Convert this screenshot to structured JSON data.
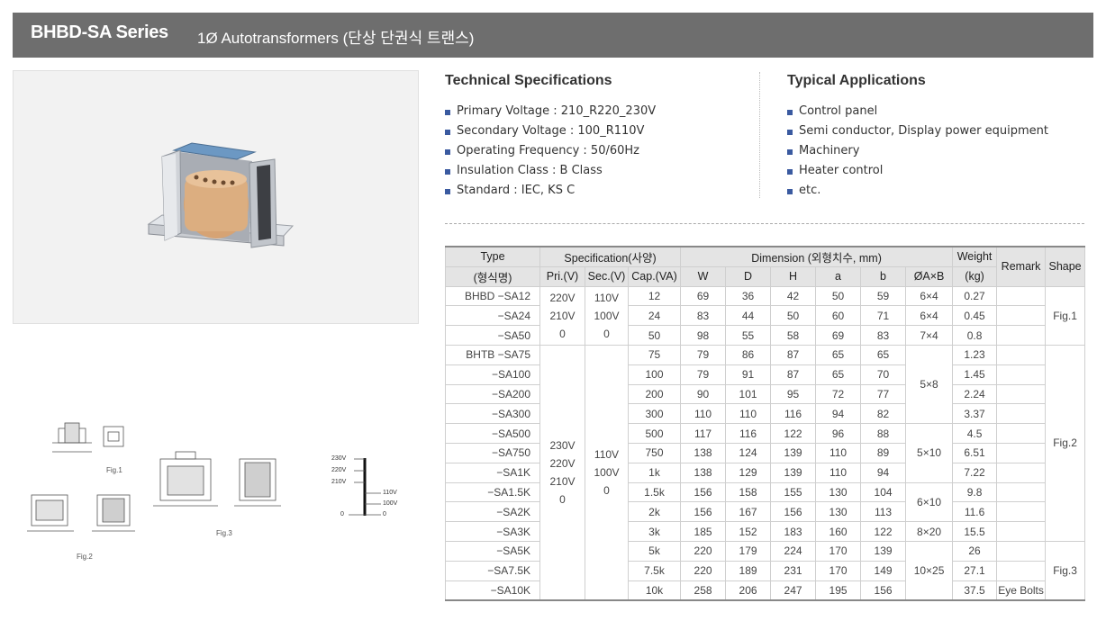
{
  "header": {
    "series": "BHBD-SA Series",
    "subtitle": "1Ø Autotransformers (단상 단권식 트랜스)"
  },
  "tech_specs": {
    "title": "Technical Specifications",
    "items": [
      "Primary Voltage : 210_R220_230V",
      "Secondary Voltage : 100_R110V",
      "Operating Frequency : 50/60Hz",
      "Insulation Class : B Class",
      "Standard : IEC, KS C"
    ]
  },
  "applications": {
    "title": "Typical Applications",
    "items": [
      "Control panel",
      "Semi conductor, Display power equipment",
      "Machinery",
      "Heater control",
      "etc."
    ]
  },
  "table": {
    "h_type": "Type",
    "h_type_kr": "(형식명)",
    "h_spec": "Specification(사양)",
    "h_dim": "Dimension (외형치수, mm)",
    "h_weight": "Weight",
    "h_weight_unit": "(kg)",
    "h_remark": "Remark",
    "h_shape": "Shape",
    "h_pri": "Pri.(V)",
    "h_sec": "Sec.(V)",
    "h_cap": "Cap.(VA)",
    "h_w": "W",
    "h_d": "D",
    "h_h": "H",
    "h_a": "a",
    "h_b": "b",
    "h_ab": "ØA×B",
    "g1_pri": [
      "220V",
      "210V",
      "0"
    ],
    "g1_sec": [
      "110V",
      "100V",
      "0"
    ],
    "g2_pri": [
      "230V",
      "220V",
      "210V",
      "0"
    ],
    "g2_sec": [
      "110V",
      "100V",
      "0"
    ],
    "hole_1": "5×8",
    "hole_2": "5×10",
    "hole_3": "6×10",
    "hole_4": "8×20",
    "hole_5": "10×25",
    "shape_1": "Fig.1",
    "shape_2": "Fig.2",
    "shape_3": "Fig.3",
    "rows": [
      {
        "type": "BHBD −SA12",
        "cap": "12",
        "w": "69",
        "d": "36",
        "h": "42",
        "a": "50",
        "b": "59",
        "ab": "6×4",
        "wt": "0.27",
        "rm": ""
      },
      {
        "type": "−SA24",
        "cap": "24",
        "w": "83",
        "d": "44",
        "h": "50",
        "a": "60",
        "b": "71",
        "ab": "6×4",
        "wt": "0.45",
        "rm": ""
      },
      {
        "type": "−SA50",
        "cap": "50",
        "w": "98",
        "d": "55",
        "h": "58",
        "a": "69",
        "b": "83",
        "ab": "7×4",
        "wt": "0.8",
        "rm": ""
      },
      {
        "type": "BHTB −SA75",
        "cap": "75",
        "w": "79",
        "d": "86",
        "h": "87",
        "a": "65",
        "b": "65",
        "wt": "1.23",
        "rm": ""
      },
      {
        "type": "−SA100",
        "cap": "100",
        "w": "79",
        "d": "91",
        "h": "87",
        "a": "65",
        "b": "70",
        "wt": "1.45",
        "rm": ""
      },
      {
        "type": "−SA200",
        "cap": "200",
        "w": "90",
        "d": "101",
        "h": "95",
        "a": "72",
        "b": "77",
        "wt": "2.24",
        "rm": ""
      },
      {
        "type": "−SA300",
        "cap": "300",
        "w": "110",
        "d": "110",
        "h": "116",
        "a": "94",
        "b": "82",
        "wt": "3.37",
        "rm": ""
      },
      {
        "type": "−SA500",
        "cap": "500",
        "w": "117",
        "d": "116",
        "h": "122",
        "a": "96",
        "b": "88",
        "wt": "4.5",
        "rm": ""
      },
      {
        "type": "−SA750",
        "cap": "750",
        "w": "138",
        "d": "124",
        "h": "139",
        "a": "110",
        "b": "89",
        "wt": "6.51",
        "rm": ""
      },
      {
        "type": "−SA1K",
        "cap": "1k",
        "w": "138",
        "d": "129",
        "h": "139",
        "a": "110",
        "b": "94",
        "wt": "7.22",
        "rm": ""
      },
      {
        "type": "−SA1.5K",
        "cap": "1.5k",
        "w": "156",
        "d": "158",
        "h": "155",
        "a": "130",
        "b": "104",
        "wt": "9.8",
        "rm": ""
      },
      {
        "type": "−SA2K",
        "cap": "2k",
        "w": "156",
        "d": "167",
        "h": "156",
        "a": "130",
        "b": "113",
        "wt": "11.6",
        "rm": ""
      },
      {
        "type": "−SA3K",
        "cap": "3k",
        "w": "185",
        "d": "152",
        "h": "183",
        "a": "160",
        "b": "122",
        "wt": "15.5",
        "rm": ""
      },
      {
        "type": "−SA5K",
        "cap": "5k",
        "w": "220",
        "d": "179",
        "h": "224",
        "a": "170",
        "b": "139",
        "wt": "26",
        "rm": ""
      },
      {
        "type": "−SA7.5K",
        "cap": "7.5k",
        "w": "220",
        "d": "189",
        "h": "231",
        "a": "170",
        "b": "149",
        "wt": "27.1",
        "rm": ""
      },
      {
        "type": "−SA10K",
        "cap": "10k",
        "w": "258",
        "d": "206",
        "h": "247",
        "a": "195",
        "b": "156",
        "wt": "37.5",
        "rm": "Eye Bolts"
      }
    ]
  },
  "figures": {
    "fig1": "Fig.1",
    "fig2": "Fig.2",
    "fig3": "Fig.3",
    "v230": "230V",
    "v220": "220V",
    "v210": "210V",
    "v0_left": "0",
    "v110": "110V",
    "v100": "100V",
    "v0_right": "0"
  }
}
